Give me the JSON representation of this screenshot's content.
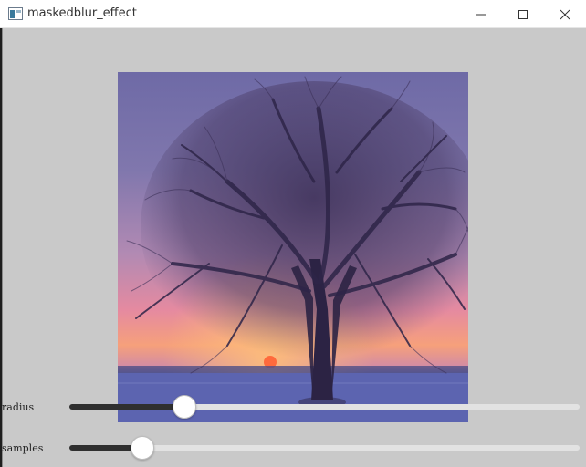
{
  "window": {
    "title": "maskedblur_effect",
    "controls": {
      "minimize_icon": "minimize-icon",
      "maximize_icon": "maximize-icon",
      "close_icon": "close-icon"
    }
  },
  "preview": {
    "image": "sunset-tree-photo"
  },
  "controls": [
    {
      "label": "radius",
      "value_fraction": 0.23
    },
    {
      "label": "samples",
      "value_fraction": 0.14
    }
  ],
  "colors": {
    "window_bg": "#c9c9c9",
    "slider_fill": "#2f2f2f",
    "slider_track": "#e2e2e2"
  }
}
